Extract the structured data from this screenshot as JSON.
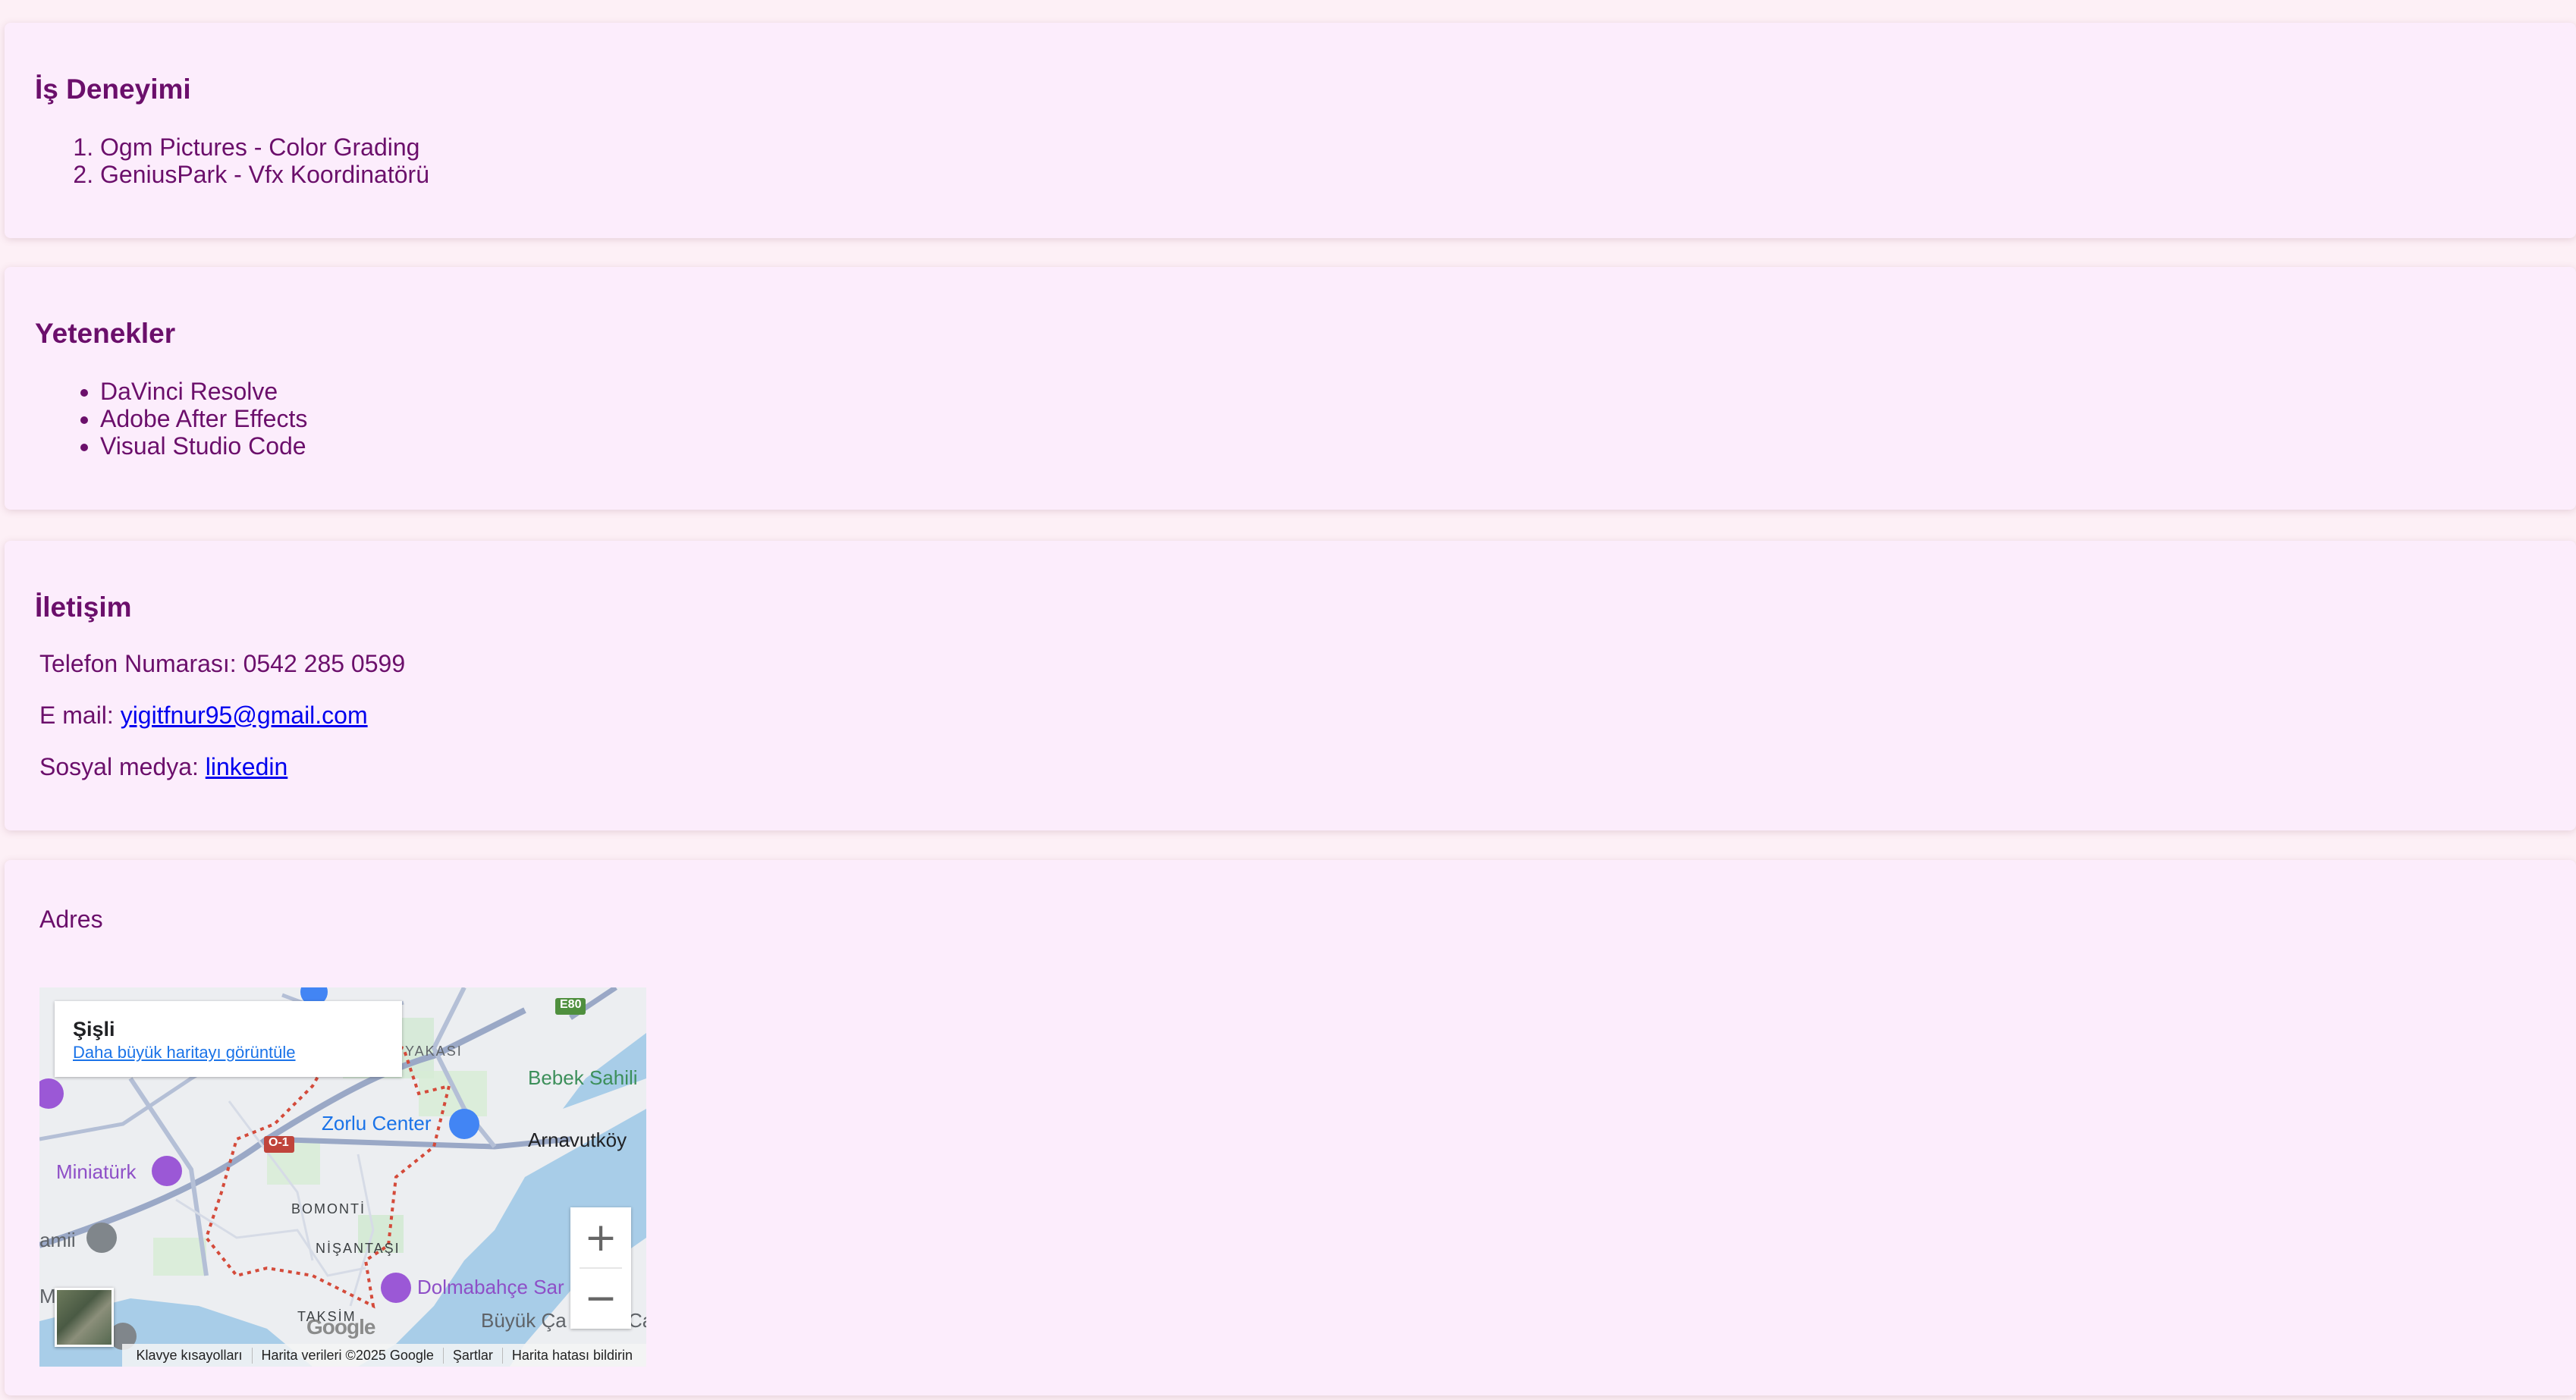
{
  "experience": {
    "title": "İş Deneyimi",
    "items": [
      "Ogm Pictures - Color Grading",
      "GeniusPark - Vfx Koordinatörü"
    ]
  },
  "skills": {
    "title": "Yetenekler",
    "items": [
      "DaVinci Resolve",
      "Adobe After Effects",
      "Visual Studio Code"
    ]
  },
  "contact": {
    "title": "İletişim",
    "phone_label": "Telefon Numarası: 0542 285 0599",
    "email_label": "E mail:",
    "email_link": "yigitfnur95@gmail.com",
    "social_label": "Sosyal medya:",
    "social_link": "linkedin"
  },
  "address": {
    "label": "Adres",
    "map": {
      "place_name": "Şişli",
      "larger_map_link": "Daha büyük haritayı görüntüle",
      "labels": {
        "zorlu": "Zorlu Center",
        "bebek": "Bebek Sahili",
        "arnavutkoy": "Arnavutköy",
        "miniaturk": "Miniatürk",
        "bomonti": "BOMONTİ",
        "nisantasi": "NİŞANTAŞI",
        "dolmabahce": "Dolmabahçe Sar",
        "taksim": "TAKSİM",
        "buyuk": "Büyük Ça",
        "yakasi": "YAKASI",
        "amii": "amii",
        "road_e80": "E80",
        "road_o1": "O-1",
        "ca": "Ca",
        "m": "M"
      },
      "google_logo": "Google",
      "zoom_in": "+",
      "zoom_out": "−",
      "footer": {
        "shortcuts": "Klavye kısayolları",
        "map_data": "Harita verileri ©2025 Google",
        "terms": "Şartlar",
        "report": "Harita hatası bildirin"
      }
    }
  }
}
